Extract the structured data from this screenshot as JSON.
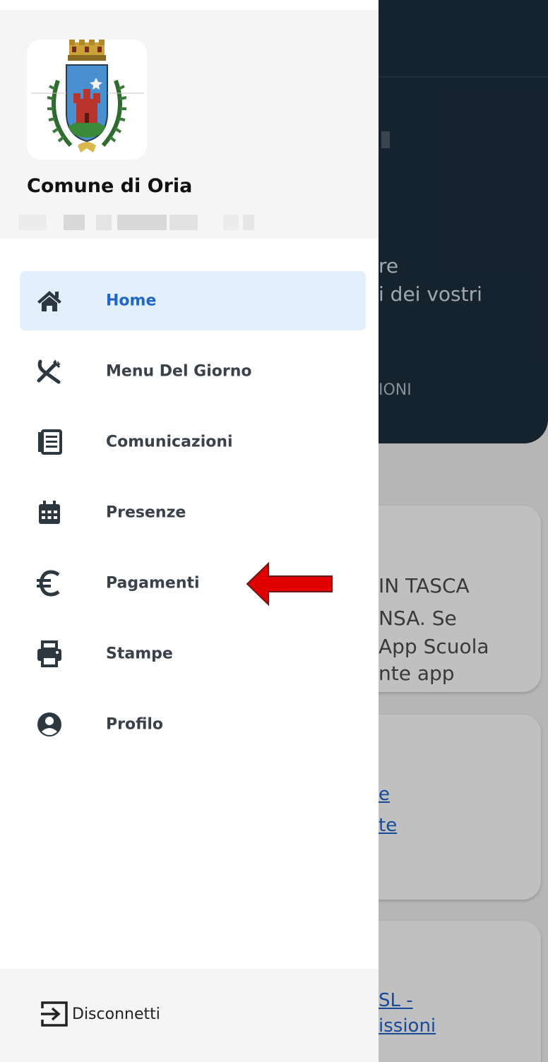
{
  "background": {
    "header_lines": [
      "re",
      "i dei vostri",
      "IONI"
    ],
    "cards": [
      {
        "lines": [
          "IN TASCA",
          "NSA. Se",
          "App Scuola",
          "nte app"
        ]
      },
      {
        "links": [
          "e",
          "te"
        ]
      },
      {
        "links": [
          "SL -",
          "issioni"
        ]
      }
    ]
  },
  "drawer": {
    "org_name": "Comune di Oria",
    "nav": [
      {
        "label": "Home",
        "icon": "home-icon",
        "active": true
      },
      {
        "label": "Menu Del Giorno",
        "icon": "utensils-icon",
        "active": false
      },
      {
        "label": "Comunicazioni",
        "icon": "newspaper-icon",
        "active": false
      },
      {
        "label": "Presenze",
        "icon": "calendar-icon",
        "active": false
      },
      {
        "label": "Pagamenti",
        "icon": "euro-icon",
        "active": false
      },
      {
        "label": "Stampe",
        "icon": "printer-icon",
        "active": false
      },
      {
        "label": "Profilo",
        "icon": "user-circle-icon",
        "active": false
      }
    ],
    "logout_label": "Disconnetti"
  },
  "colors": {
    "active_item_bg": "#e4effc",
    "active_text": "#1f66c6",
    "header_dark": "#1c2d3c",
    "arrow_red": "#e00000"
  }
}
